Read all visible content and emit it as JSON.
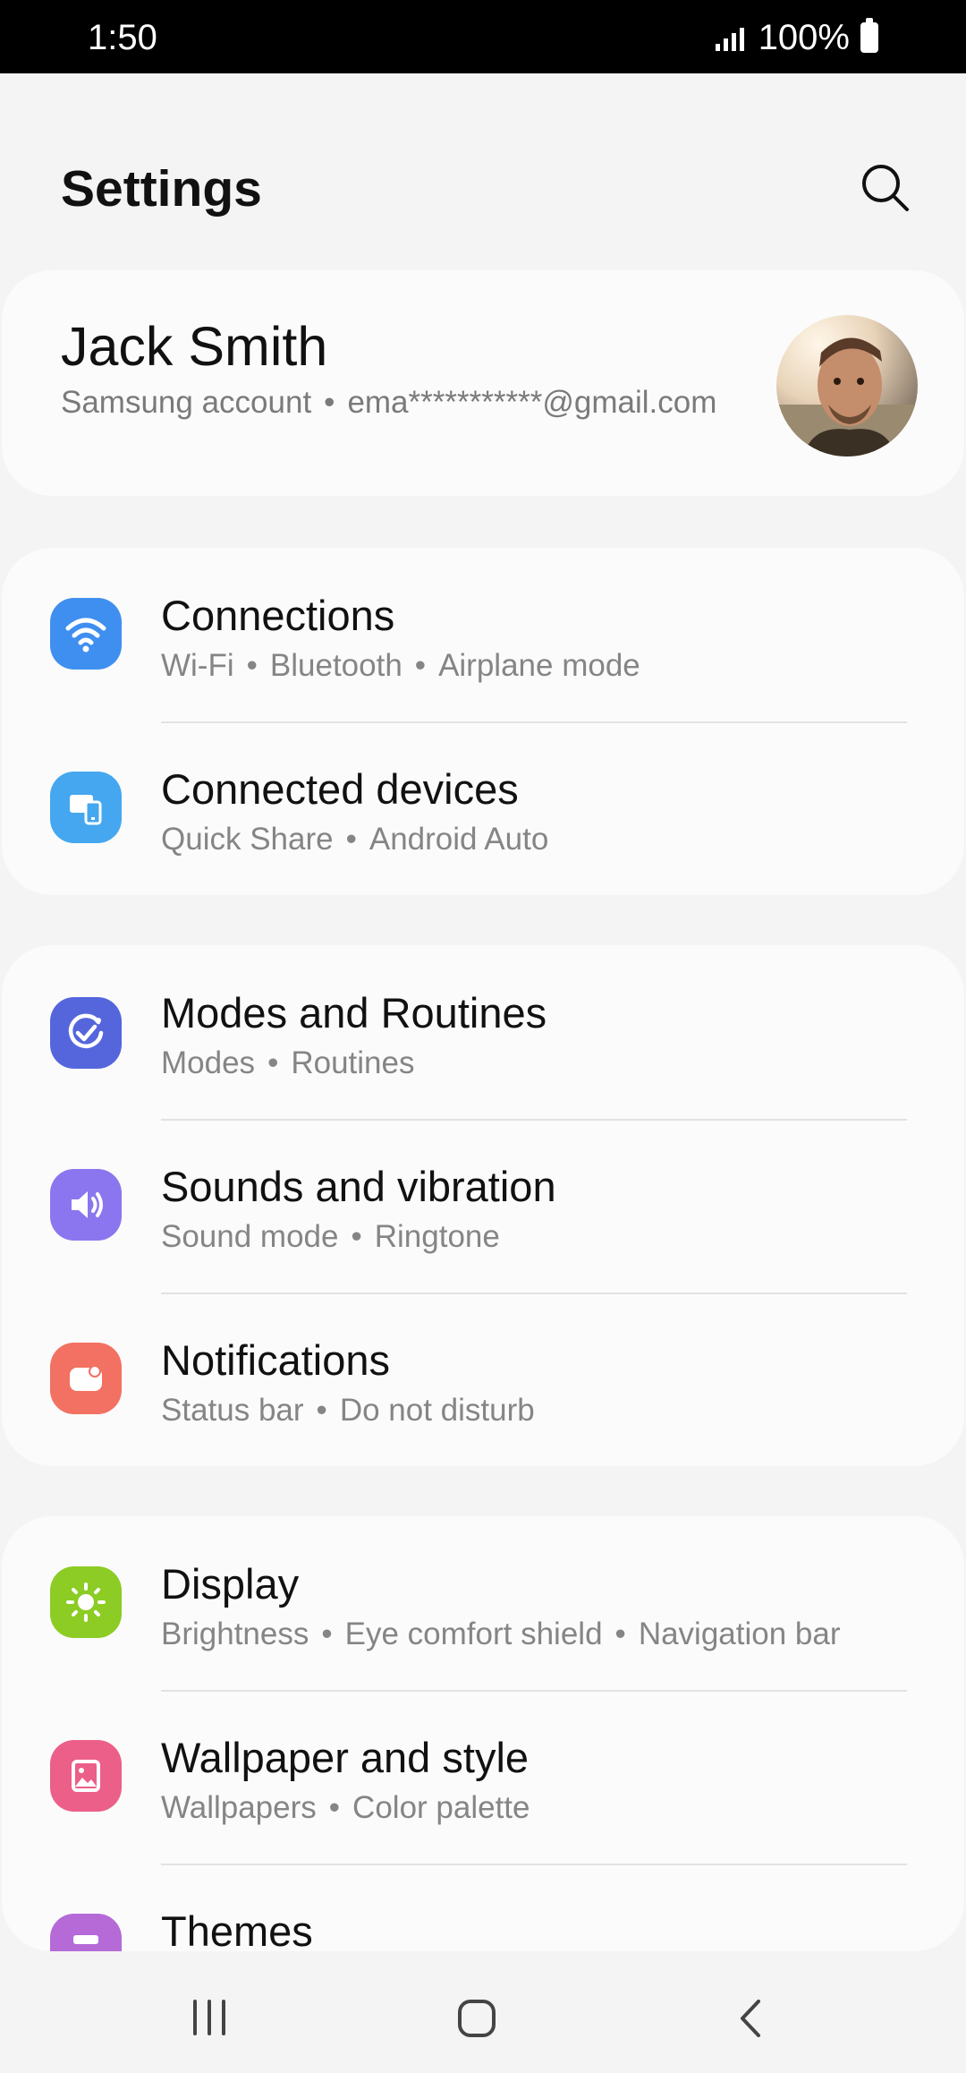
{
  "status_bar": {
    "time": "1:50",
    "battery": "100%"
  },
  "header": {
    "title": "Settings"
  },
  "profile": {
    "name": "Jack Smith",
    "account_label": "Samsung account",
    "email": "ema***********@gmail.com"
  },
  "groups": [
    {
      "items": [
        {
          "title": "Connections",
          "subs": [
            "Wi-Fi",
            "Bluetooth",
            "Airplane mode"
          ],
          "icon": "wifi-icon",
          "color": "#3f8ff0"
        },
        {
          "title": "Connected devices",
          "subs": [
            "Quick Share",
            "Android Auto"
          ],
          "icon": "devices-icon",
          "color": "#45a7ef"
        }
      ]
    },
    {
      "items": [
        {
          "title": "Modes and Routines",
          "subs": [
            "Modes",
            "Routines"
          ],
          "icon": "routine-check-icon",
          "color": "#5566dd"
        },
        {
          "title": "Sounds and vibration",
          "subs": [
            "Sound mode",
            "Ringtone"
          ],
          "icon": "speaker-icon",
          "color": "#8b76f0"
        },
        {
          "title": "Notifications",
          "subs": [
            "Status bar",
            "Do not disturb"
          ],
          "icon": "notification-icon",
          "color": "#f27162"
        }
      ]
    },
    {
      "items": [
        {
          "title": "Display",
          "subs": [
            "Brightness",
            "Eye comfort shield",
            "Navigation bar"
          ],
          "icon": "sun-icon",
          "color": "#8ccc24"
        },
        {
          "title": "Wallpaper and style",
          "subs": [
            "Wallpapers",
            "Color palette"
          ],
          "icon": "wallpaper-icon",
          "color": "#ec5f88"
        },
        {
          "title": "Themes",
          "subs": [],
          "icon": "themes-icon",
          "color": "#b56ad8"
        }
      ]
    }
  ],
  "nav": {
    "recents": "recents-icon",
    "home": "home-icon",
    "back": "back-icon"
  }
}
